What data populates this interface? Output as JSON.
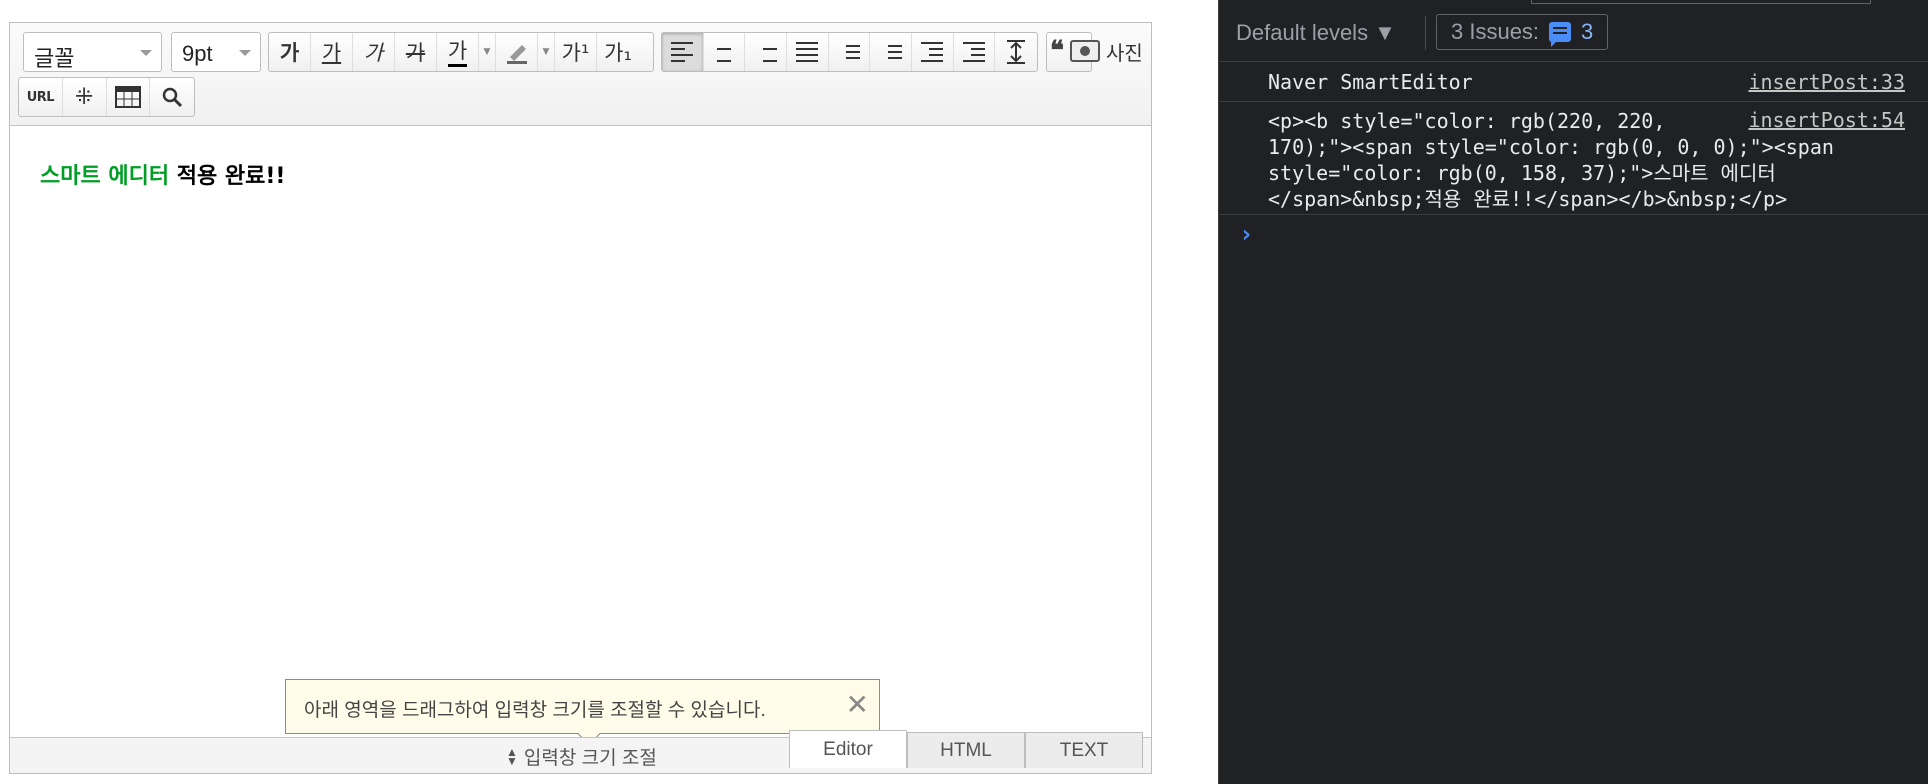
{
  "editor": {
    "font_select": "글꼴",
    "size_select": "9pt",
    "buttons": {
      "bold": "가",
      "underline": "가",
      "italic": "가",
      "strike": "가",
      "font_color": "가",
      "superscript": "가¹",
      "subscript": "가₁",
      "url": "URL"
    },
    "photo_label": "사진",
    "content": {
      "green_text": "스마트 에디터",
      "black_text": " 적용 완료!!"
    },
    "colors": {
      "green": "#009e25",
      "black": "#000000"
    },
    "tooltip": {
      "text": "아래 영역을 드래그하여 입력창 크기를 조절할 수 있습니다.",
      "close": "✕"
    },
    "resize_label": "입력창 크기 조절",
    "mode_tabs": [
      "Editor",
      "HTML",
      "TEXT"
    ],
    "active_mode": "Editor"
  },
  "devtools": {
    "levels": "Default levels ▼",
    "issues_label": "3 Issues:",
    "issues_count": "3",
    "messages": [
      {
        "text": "Naver SmartEditor",
        "source": "insertPost:33"
      },
      {
        "text": "<p><b style=\"color: rgb(220, 220,\n170);\"><span style=\"color: rgb(0, 0, 0);\"><span\nstyle=\"color: rgb(0, 158, 37);\">스마트 에디터\n</span>&nbsp;적용 완료!!</span></b>&nbsp;</p>",
        "source": "insertPost:54"
      }
    ],
    "prompt": "›"
  }
}
